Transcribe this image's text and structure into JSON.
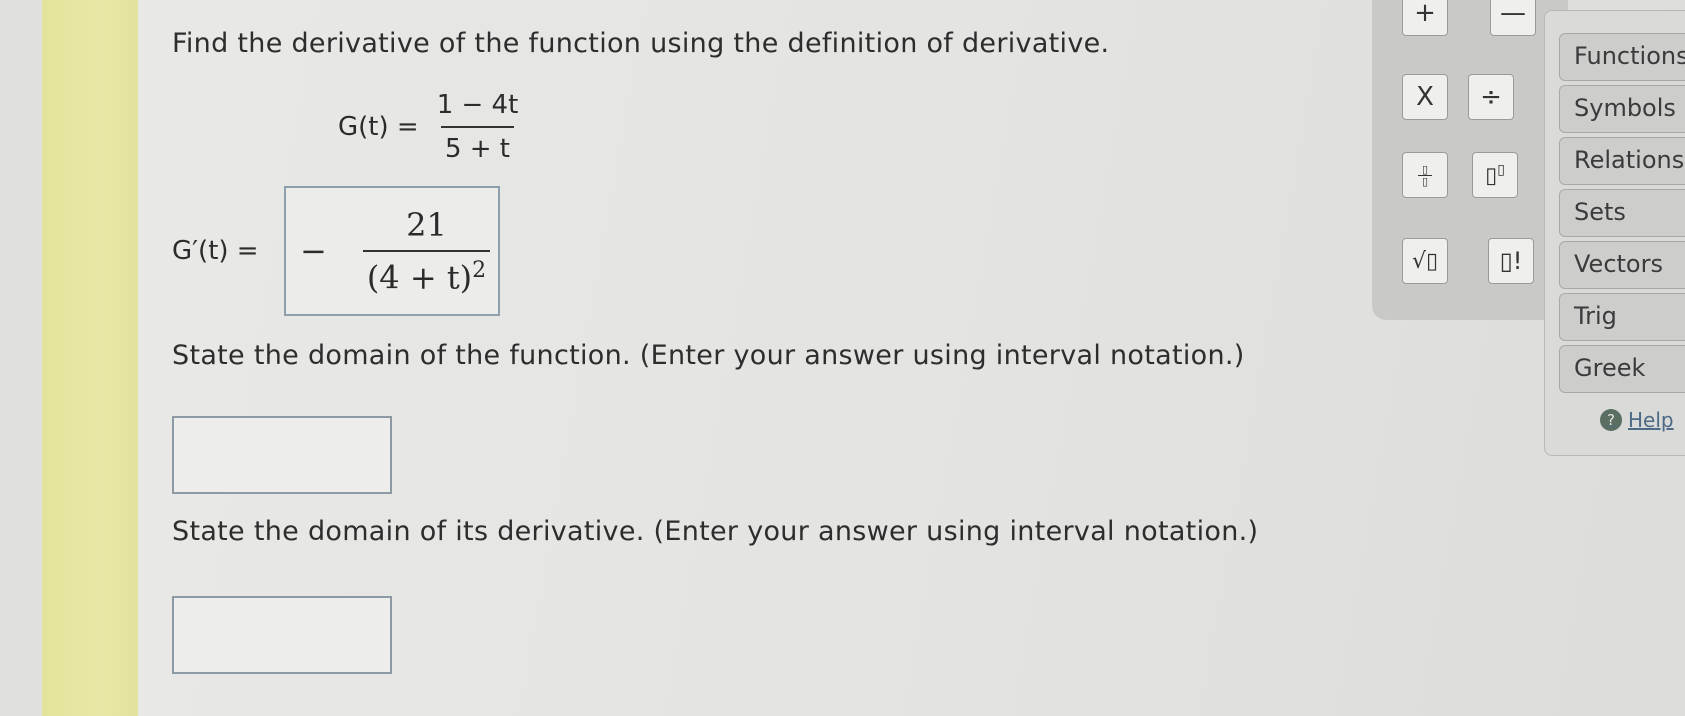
{
  "question": {
    "instruction": "Find the derivative of the function using the definition of derivative.",
    "function": {
      "lhs": "G(t) =",
      "numerator": "1 − 4t",
      "denominator": "5 + t"
    },
    "derivative": {
      "lhs": "G′(t) =",
      "answer_sign": "−",
      "answer_numerator": "21",
      "answer_denominator_base": "(4 + t)",
      "answer_denominator_exponent": "2"
    },
    "domain_function_prompt": "State the domain of the function. (Enter your answer using interval notation.)",
    "domain_function_value": "",
    "domain_derivative_prompt": "State the domain of its derivative. (Enter your answer using interval notation.)",
    "domain_derivative_value": ""
  },
  "palette": {
    "buttons": [
      {
        "name": "plus",
        "glyph": "+"
      },
      {
        "name": "minus",
        "glyph": "—"
      },
      {
        "name": "times",
        "glyph": "X"
      },
      {
        "name": "divide",
        "glyph": "÷"
      },
      {
        "name": "fraction",
        "glyph": "▯/▯"
      },
      {
        "name": "exponent",
        "glyph": "▯▯"
      },
      {
        "name": "sqrt",
        "glyph": "√▯"
      },
      {
        "name": "factorial",
        "glyph": "▯!"
      }
    ]
  },
  "tabs": [
    "Functions",
    "Symbols",
    "Relations",
    "Sets",
    "Vectors",
    "Trig",
    "Greek"
  ],
  "help": {
    "label": "Help"
  },
  "colors": {
    "margin_strip": "#e6e79f",
    "box_border": "#8ea0ad",
    "link": "#4d6a86"
  }
}
